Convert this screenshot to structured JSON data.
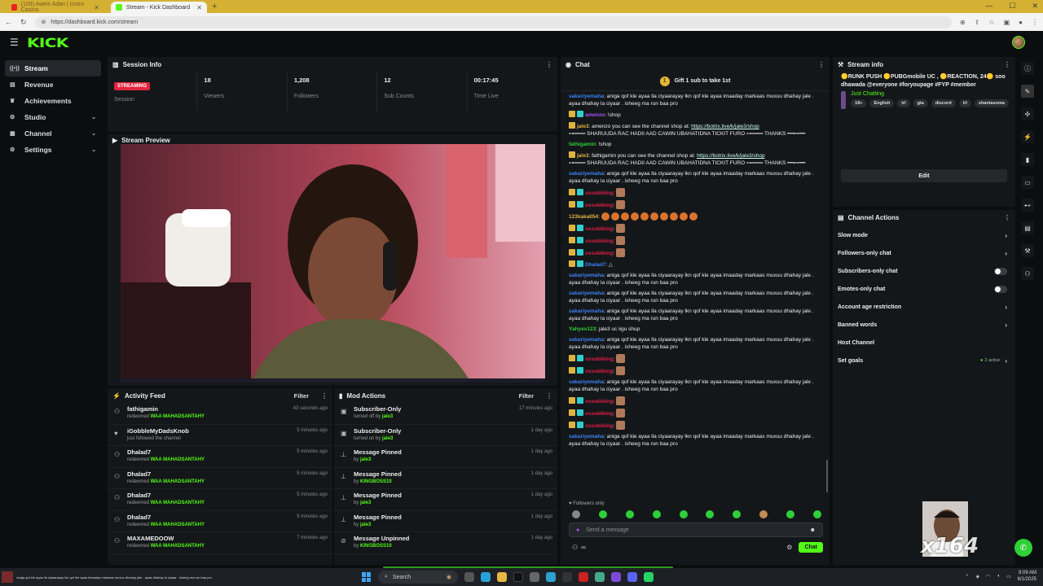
{
  "browser": {
    "tabs": [
      {
        "title": "(109) Aweis Adan | Instro Casino",
        "active": false
      },
      {
        "title": "Stream - Kick Dashboard",
        "active": true
      }
    ],
    "url": "https://dashboard.kick.com/stream"
  },
  "app": {
    "logo": "KICK",
    "accent": "#53fc18"
  },
  "sidebar": {
    "items": [
      {
        "label": "Stream",
        "icon": "broadcast-icon",
        "active": true
      },
      {
        "label": "Revenue",
        "icon": "wallet-icon"
      },
      {
        "label": "Achievements",
        "icon": "trophy-icon"
      },
      {
        "label": "Studio",
        "icon": "studio-icon",
        "expandable": true
      },
      {
        "label": "Channel",
        "icon": "channel-icon",
        "expandable": true
      },
      {
        "label": "Settings",
        "icon": "gear-icon",
        "expandable": true
      }
    ]
  },
  "session": {
    "title": "Session Info",
    "status_badge": "STREAMING",
    "stats": [
      {
        "value": "",
        "label": "Session"
      },
      {
        "value": "18",
        "label": "Viewers"
      },
      {
        "value": "1,208",
        "label": "Followers"
      },
      {
        "value": "12",
        "label": "Sub Counts"
      },
      {
        "value": "00:17:45",
        "label": "Time Live"
      }
    ]
  },
  "preview": {
    "title": "Stream Preview"
  },
  "activity": {
    "title": "Activity Feed",
    "filter": "Filter",
    "rows": [
      {
        "user": "fathigamin",
        "action": "redeemed",
        "reward": "WAA MAHADSANTAHY",
        "time": "43 seconds ago",
        "icon": "gift-icon"
      },
      {
        "user": "iGobbleMyDadsKnob",
        "action": "just followed the channel",
        "reward": "",
        "time": "5 minutes ago",
        "icon": "heart-icon"
      },
      {
        "user": "Dhalad7",
        "action": "redeemed",
        "reward": "WAA MAHADSANTAHY",
        "time": "5 minutes ago",
        "icon": "gift-icon"
      },
      {
        "user": "Dhalad7",
        "action": "redeemed",
        "reward": "WAA MAHADSANTAHY",
        "time": "5 minutes ago",
        "icon": "gift-icon"
      },
      {
        "user": "Dhalad7",
        "action": "redeemed",
        "reward": "WAA MAHADSANTAHY",
        "time": "5 minutes ago",
        "icon": "gift-icon"
      },
      {
        "user": "Dhalad7",
        "action": "redeemed",
        "reward": "WAA MAHADSANTAHY",
        "time": "5 minutes ago",
        "icon": "gift-icon"
      },
      {
        "user": "MAXAMEDOOW",
        "action": "redeemed",
        "reward": "WAA MAHADSANTAHY",
        "time": "7 minutes ago",
        "icon": "gift-icon"
      }
    ]
  },
  "mod": {
    "title": "Mod Actions",
    "filter": "Filter",
    "rows": [
      {
        "title": "Subscriber-Only",
        "prefix": "turned off by",
        "by": "jale3",
        "time": "17 minutes ago",
        "icon": "lock-icon"
      },
      {
        "title": "Subscriber-Only",
        "prefix": "turned on by",
        "by": "jale3",
        "time": "1 day ago",
        "icon": "lock-icon"
      },
      {
        "title": "Message Pinned",
        "prefix": "by",
        "by": "jale3",
        "time": "1 day ago",
        "icon": "pin-icon"
      },
      {
        "title": "Message Pinned",
        "prefix": "by",
        "by": "KINGBOSS10",
        "time": "1 day ago",
        "icon": "pin-icon"
      },
      {
        "title": "Message Pinned",
        "prefix": "by",
        "by": "jale3",
        "time": "1 day ago",
        "icon": "pin-icon"
      },
      {
        "title": "Message Pinned",
        "prefix": "by",
        "by": "jale3",
        "time": "1 day ago",
        "icon": "pin-icon"
      },
      {
        "title": "Message Unpinned",
        "prefix": "by",
        "by": "KINGBOSS10",
        "time": "1 day ago",
        "icon": "unpin-icon"
      }
    ]
  },
  "chat": {
    "title": "Chat",
    "gift_text": "Gift 1 sub to take 1st",
    "followers_only": "Followers only",
    "placeholder": "Send a message",
    "send_label": "Chat",
    "messages": [
      {
        "user": "sakariyemaha",
        "color": "#3b82f6",
        "text": "aniga qof kle ayaa lla ciyaarayay lkn qof kle ayaa imaaday markaas muxuu dhahay jale . ayaa dhahay la ciyaar . isheeg ma run baa pro"
      },
      {
        "user": "amenzo",
        "color": "#a855f7",
        "text": "!shop",
        "badges": 2
      },
      {
        "user": "jale3",
        "color": "#e0b341",
        "text": "amenzo you can see the channel shop at: ",
        "link": "https://botrix.live/k/jale3/shop",
        "extra": "⊶═══ SHARUUDA RAC HADII AAD CAWIN UBAHATIDNA TICKIT FURO ⊶═══ THANKS ━━⊷━━",
        "badges": 1
      },
      {
        "user": "fathigamin",
        "color": "#2fcf3a",
        "text": "!shop"
      },
      {
        "user": "jale3",
        "color": "#e0b341",
        "text": "fathigamin you can see the channel shop at: ",
        "link": "https://botrix.live/k/jale3/shop",
        "extra": "⊶═══ SHARUUDA RAC HADII AAD CAWIN UBAHATIDNA TICKIT FURO ⊶═══ THANKS ━━⊷━━",
        "badges": 1
      },
      {
        "user": "sakariyemaha",
        "color": "#3b82f6",
        "text": "aniga qof kle ayaa lla ciyaarayay lkn qof kle ayaa imaaday markaas muxuu dhahay jale . ayaa dhahay la ciyaar . isheeg ma run baa pro"
      },
      {
        "user": "ossoblking",
        "color": "#e11d48",
        "emotes": 1,
        "badges": 2
      },
      {
        "user": "ossoblking",
        "color": "#e11d48",
        "emotes": 1,
        "badges": 2
      },
      {
        "user": "123kaka054",
        "color": "#e0b341",
        "emotes_round": 10
      },
      {
        "user": "ossoblking",
        "color": "#e11d48",
        "emotes": 1,
        "badges": 2
      },
      {
        "user": "ossoblking",
        "color": "#e11d48",
        "emotes": 1,
        "badges": 2
      },
      {
        "user": "ossoblking",
        "color": "#e11d48",
        "emotes": 1,
        "badges": 2
      },
      {
        "user": "Dhalad7",
        "color": "#3b82f6",
        "text": "△",
        "badges": 2
      },
      {
        "user": "sakariyemaha",
        "color": "#3b82f6",
        "text": "aniga qof kle ayaa lla ciyaarayay lkn qof kle ayaa imaaday markaas muxuu dhahay jale . ayaa dhahay la ciyaar . isheeg ma run baa pro"
      },
      {
        "user": "sakariyemaha",
        "color": "#3b82f6",
        "text": "aniga qof kle ayaa lla ciyaarayay lkn qof kle ayaa imaaday markaas muxuu dhahay jale . ayaa dhahay la ciyaar . isheeg ma run baa pro"
      },
      {
        "user": "sakariyemaha",
        "color": "#3b82f6",
        "text": "aniga qof kle ayaa lla ciyaarayay lkn qof kle ayaa imaaday markaas muxuu dhahay jale . ayaa dhahay la ciyaar . isheeg ma run baa pro"
      },
      {
        "user": "Yahyes123",
        "color": "#2fcf3a",
        "text": "jale3 uc iigu shup"
      },
      {
        "user": "sakariyemaha",
        "color": "#3b82f6",
        "text": "aniga qof kle ayaa lla ciyaarayay lkn qof kle ayaa imaaday markaas muxuu dhahay jale . ayaa dhahay la ciyaar . isheeg ma run baa pro"
      },
      {
        "user": "ossoblking",
        "color": "#e11d48",
        "emotes": 1,
        "badges": 2
      },
      {
        "user": "ossoblking",
        "color": "#e11d48",
        "emotes": 1,
        "badges": 2
      },
      {
        "user": "sakariyemaha",
        "color": "#3b82f6",
        "text": "aniga qof kle ayaa lla ciyaarayay lkn qof kle ayaa imaaday markaas muxuu dhahay jale . ayaa dhahay la ciyaar . isheeg ma run baa pro"
      },
      {
        "user": "ossoblking",
        "color": "#e11d48",
        "emotes": 1,
        "badges": 2
      },
      {
        "user": "ossoblking",
        "color": "#e11d48",
        "emotes": 1,
        "badges": 2
      },
      {
        "user": "ossoblking",
        "color": "#e11d48",
        "emotes": 1,
        "badges": 2
      },
      {
        "user": "sakariyemaha",
        "color": "#3b82f6",
        "text": "aniga qof kle ayaa lla ciyaarayay lkn qof kle ayaa imaaday markaas muxuu dhahay jale . ayaa dhahay la ciyaar . isheeg ma run baa pro"
      }
    ]
  },
  "stream_info": {
    "title": "Stream info",
    "stream_title": "🟡RUNK PUSH 🟡PUBGmobile UC , 🟡REACTION, 24🟡 soo dhawada @everyone #foryoupage #FYP #member",
    "category": "Just Chatting",
    "tags": [
      "18+",
      "English",
      "irl",
      "gta",
      "discord",
      "irl",
      "shantasoma"
    ],
    "edit_label": "Edit"
  },
  "channel_actions": {
    "title": "Channel Actions",
    "rows": [
      {
        "label": "Slow mode",
        "control": "arrow"
      },
      {
        "label": "Followers-only chat",
        "control": "arrow"
      },
      {
        "label": "Subscribers-only chat",
        "control": "toggle"
      },
      {
        "label": "Emotes-only chat",
        "control": "toggle"
      },
      {
        "label": "Account age restriction",
        "control": "arrow"
      },
      {
        "label": "Banned words",
        "control": "arrow"
      },
      {
        "label": "Host Channel",
        "control": "none"
      },
      {
        "label": "Set goals",
        "control": "goals",
        "extra": "2 active"
      }
    ]
  },
  "overlay": {
    "combo": "x164"
  },
  "taskbar": {
    "ticker": "aniga qof kle ayaa lla ciyaarayay lkn qof kle ayaa imaaday markaas muxuu dhahay jale . ayaa dhahay la ciyaar . isheeg ma run baa pro",
    "search": "Search",
    "time": "9:09 AM",
    "date": "8/1/2025"
  }
}
